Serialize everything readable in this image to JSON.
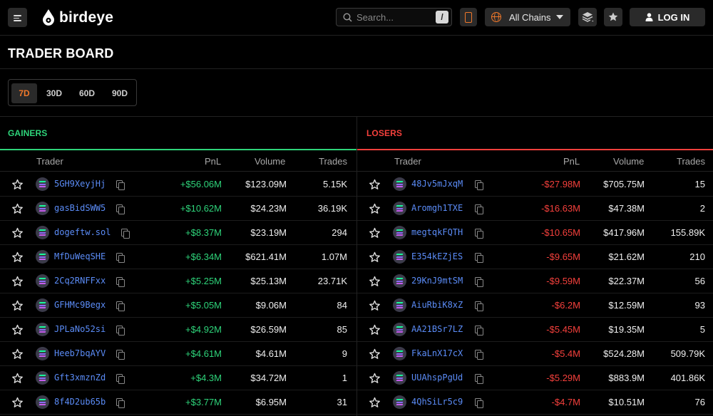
{
  "brand": {
    "name": "birdeye"
  },
  "search": {
    "placeholder": "Search...",
    "shortcut": "/"
  },
  "chain_selector": {
    "label": "All Chains"
  },
  "login": {
    "label": "LOG IN"
  },
  "page_title": "TRADER BOARD",
  "periods": [
    {
      "label": "7D",
      "active": true
    },
    {
      "label": "30D",
      "active": false
    },
    {
      "label": "60D",
      "active": false
    },
    {
      "label": "90D",
      "active": false
    }
  ],
  "colors": {
    "accent": "#f0782a",
    "gain": "#2ed47a",
    "loss": "#f5403c",
    "address": "#5b8cf7"
  },
  "columns": {
    "trader": "Trader",
    "pnl": "PnL",
    "volume": "Volume",
    "trades": "Trades"
  },
  "gainers": {
    "title": "GAINERS",
    "rows": [
      {
        "trader": "5GH9XeyjHj",
        "pnl": "+$56.06M",
        "volume": "$123.09M",
        "trades": "5.15K"
      },
      {
        "trader": "gasBidSWW5",
        "pnl": "+$10.62M",
        "volume": "$24.23M",
        "trades": "36.19K"
      },
      {
        "trader": "dogeftw.sol",
        "pnl": "+$8.37M",
        "volume": "$23.19M",
        "trades": "294"
      },
      {
        "trader": "MfDuWeqSHE",
        "pnl": "+$6.34M",
        "volume": "$621.41M",
        "trades": "1.07M"
      },
      {
        "trader": "2Cq2RNFFxx",
        "pnl": "+$5.25M",
        "volume": "$25.13M",
        "trades": "23.71K"
      },
      {
        "trader": "GFHMc9Begx",
        "pnl": "+$5.05M",
        "volume": "$9.06M",
        "trades": "84"
      },
      {
        "trader": "JPLaNo52si",
        "pnl": "+$4.92M",
        "volume": "$26.59M",
        "trades": "85"
      },
      {
        "trader": "Heeb7bqAYV",
        "pnl": "+$4.61M",
        "volume": "$4.61M",
        "trades": "9"
      },
      {
        "trader": "Gft3xmznZd",
        "pnl": "+$4.3M",
        "volume": "$34.72M",
        "trades": "1"
      },
      {
        "trader": "8f4D2ub65b",
        "pnl": "+$3.77M",
        "volume": "$6.95M",
        "trades": "31"
      }
    ]
  },
  "losers": {
    "title": "LOSERS",
    "rows": [
      {
        "trader": "48Jv5mJxqM",
        "pnl": "-$27.98M",
        "volume": "$705.75M",
        "trades": "15"
      },
      {
        "trader": "Aromgh1TXE",
        "pnl": "-$16.63M",
        "volume": "$47.38M",
        "trades": "2"
      },
      {
        "trader": "megtqkFQTH",
        "pnl": "-$10.65M",
        "volume": "$417.96M",
        "trades": "155.89K"
      },
      {
        "trader": "E354kEZjES",
        "pnl": "-$9.65M",
        "volume": "$21.62M",
        "trades": "210"
      },
      {
        "trader": "29KnJ9mtSM",
        "pnl": "-$9.59M",
        "volume": "$22.37M",
        "trades": "56"
      },
      {
        "trader": "AiuRbiK8xZ",
        "pnl": "-$6.2M",
        "volume": "$12.59M",
        "trades": "93"
      },
      {
        "trader": "AA21BSr7LZ",
        "pnl": "-$5.45M",
        "volume": "$19.35M",
        "trades": "5"
      },
      {
        "trader": "FkaLnX17cX",
        "pnl": "-$5.4M",
        "volume": "$524.28M",
        "trades": "509.79K"
      },
      {
        "trader": "UUAhspPgUd",
        "pnl": "-$5.29M",
        "volume": "$883.9M",
        "trades": "401.86K"
      },
      {
        "trader": "4QhSiLr5c9",
        "pnl": "-$4.7M",
        "volume": "$10.51M",
        "trades": "76"
      }
    ]
  }
}
